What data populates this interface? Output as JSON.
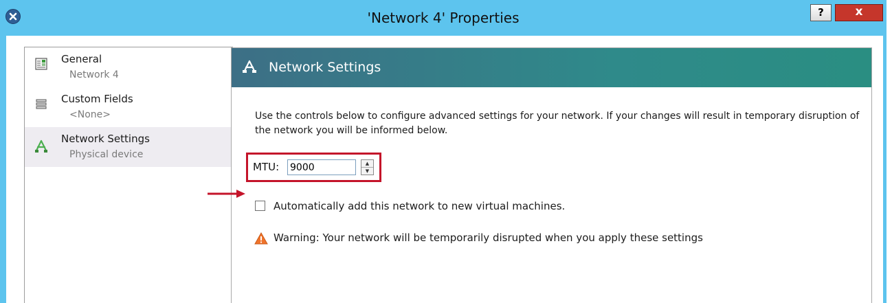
{
  "window": {
    "title": "'Network 4' Properties",
    "help_label": "?",
    "close_label": "x"
  },
  "nav": {
    "items": [
      {
        "label": "General",
        "sub": "Network 4",
        "icon": "general-icon",
        "selected": false
      },
      {
        "label": "Custom Fields",
        "sub": "<None>",
        "icon": "list-icon",
        "selected": false
      },
      {
        "label": "Network Settings",
        "sub": "Physical device",
        "icon": "network-icon",
        "selected": true
      }
    ]
  },
  "content": {
    "header_title": "Network Settings",
    "header_icon": "network-icon",
    "description": "Use the controls below to configure advanced settings for your network. If your changes will result in temporary disruption of the network you will be informed below.",
    "mtu_label": "MTU:",
    "mtu_value": "9000",
    "auto_add_label": "Automatically add this network to new virtual machines.",
    "auto_add_checked": false,
    "warning_text": "Warning: Your network will be temporarily disrupted when you apply these settings"
  },
  "colors": {
    "titlebar": "#5dc4ee",
    "header_gradient_start": "#3d6f86",
    "header_gradient_end": "#2a8e82",
    "highlight": "#c4142a",
    "warning": "#f0742b",
    "selected_item": "#eeecf1"
  }
}
